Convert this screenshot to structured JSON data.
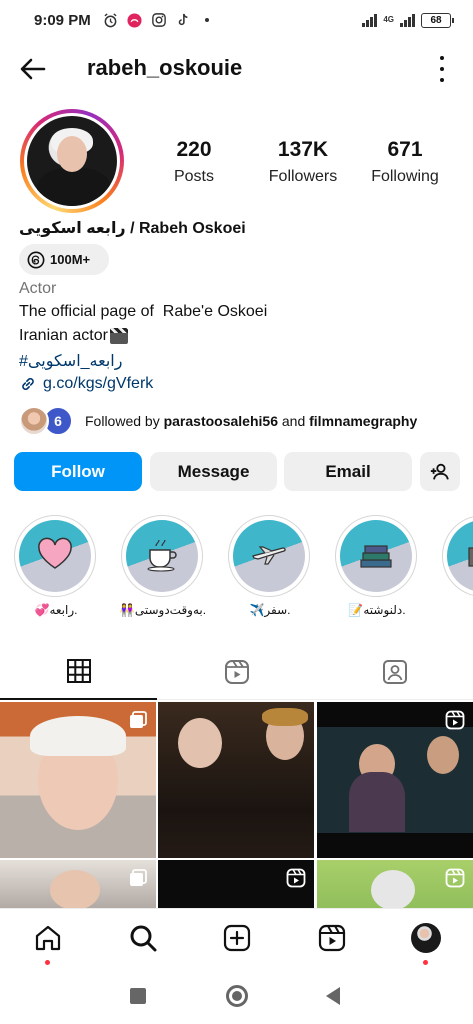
{
  "status_bar": {
    "time": "9:09 PM",
    "network": "4G",
    "battery": "68"
  },
  "header": {
    "username": "rabeh_oskouie"
  },
  "profile": {
    "stats": {
      "posts_count": "220",
      "posts_label": "Posts",
      "followers_count": "137K",
      "followers_label": "Followers",
      "following_count": "671",
      "following_label": "Following"
    },
    "full_name": "رابعه اسکویی / Rabeh Oskoei",
    "threads_badge": "100M+",
    "category": "Actor",
    "bio_line1": "The official page of  Rabe'e Oskoei",
    "bio_line2": "Iranian actor",
    "hashtag": "#رابعه_اسکویی",
    "link": "g.co/kgs/gVferk",
    "followed_by": {
      "prefix": "Followed by ",
      "user1": "parastoosalehi56",
      "conjunction": " and ",
      "user2": "filmnamegraphy"
    }
  },
  "actions": {
    "follow": "Follow",
    "message": "Message",
    "email": "Email"
  },
  "highlights": [
    {
      "label": "💞رابعه."
    },
    {
      "label": "👭به‌وقت‌دوستی."
    },
    {
      "label": "✈️سفر."
    },
    {
      "label": "📝دلنوشته."
    },
    {
      "label": "🎬"
    }
  ],
  "tabs": [
    "grid-tab",
    "reels-tab",
    "tagged-tab"
  ],
  "colors": {
    "primary_blue": "#0095f6",
    "link_blue": "#00376b",
    "button_gray": "#efefef",
    "notification_red": "#ff3040"
  }
}
